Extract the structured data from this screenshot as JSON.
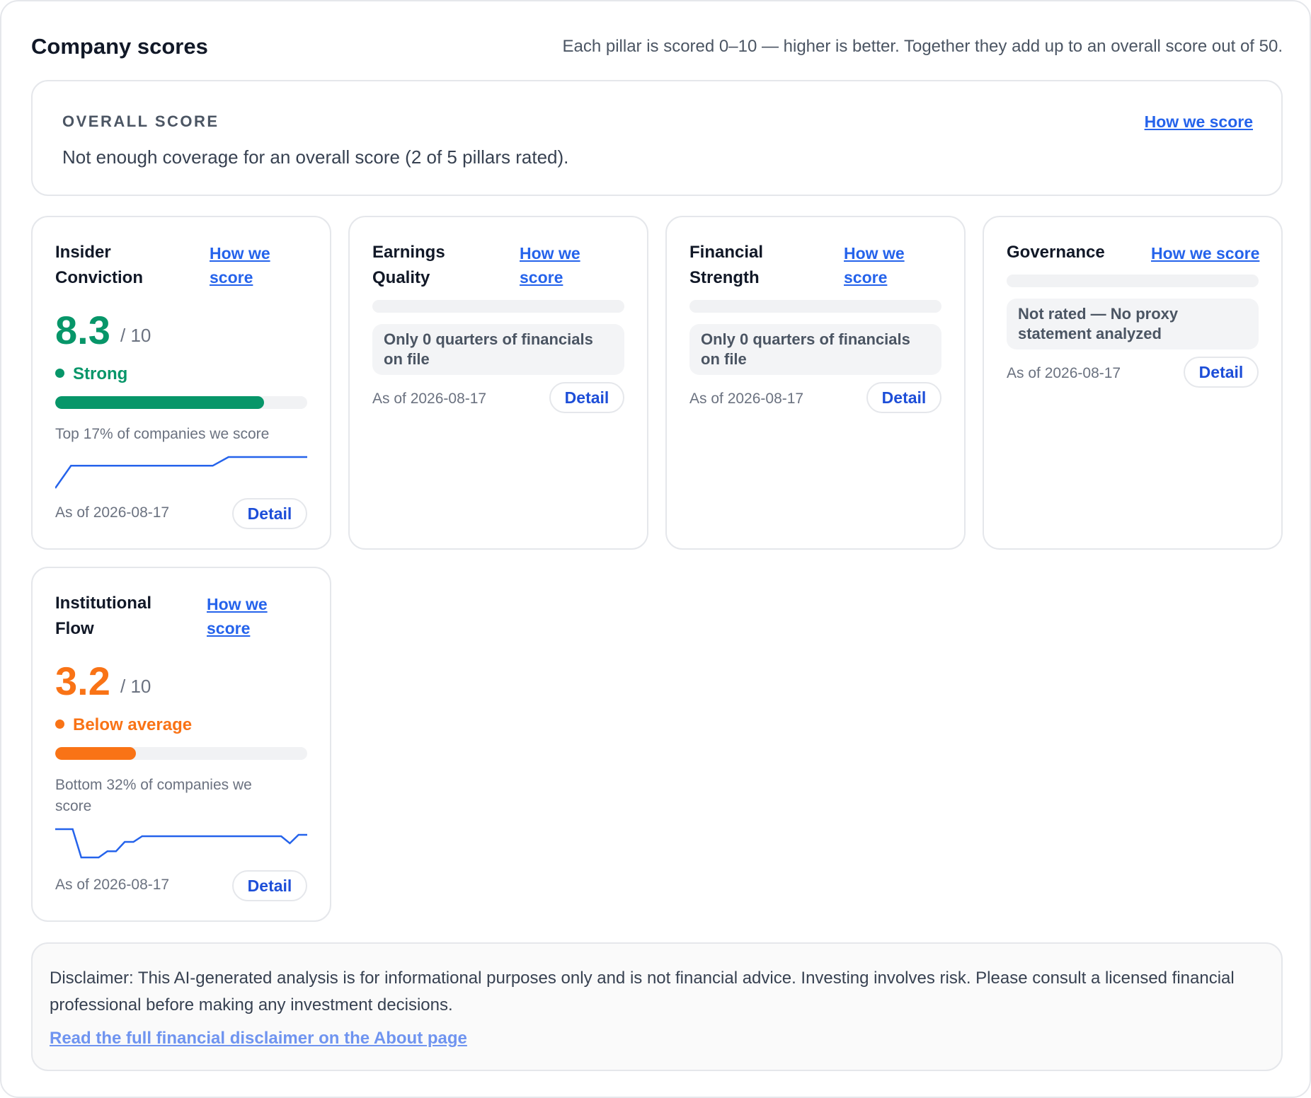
{
  "header": {
    "title": "Company scores",
    "subtitle": "Each pillar is scored 0–10 — higher is better. Together they add up to an overall score out of 50."
  },
  "overall": {
    "label": "OVERALL SCORE",
    "message": "Not enough coverage for an overall score (2 of 5 pillars rated).",
    "how_label": "How we score"
  },
  "pillars": [
    {
      "name": "Insider Conviction",
      "how_label": "How we score",
      "score": "8.3",
      "out_of": "/ 10",
      "band": "Strong",
      "bar_fraction": 0.83,
      "percentile": "Top 17% of companies we score",
      "trend": [
        0,
        0.72,
        0.72,
        0.72,
        0.72,
        0.72,
        0.72,
        0.72,
        0.72,
        0.72,
        0.72,
        1,
        1,
        1,
        1,
        1,
        1
      ],
      "as_of": "As of 2026-08-17",
      "detail_label": "Detail"
    },
    {
      "name": "Earnings Quality",
      "how_label": "How we score",
      "note": "Only 0 quarters of financials on file",
      "as_of": "As of 2026-08-17",
      "detail_label": "Detail"
    },
    {
      "name": "Financial Strength",
      "how_label": "How we score",
      "note": "Only 0 quarters of financials on file",
      "as_of": "As of 2026-08-17",
      "detail_label": "Detail"
    },
    {
      "name": "Governance",
      "how_label": "How we score",
      "note": "Not rated — No proxy statement analyzed",
      "as_of": "As of 2026-08-17",
      "detail_label": "Detail"
    },
    {
      "name": "Institutional Flow",
      "how_label": "How we score",
      "score": "3.2",
      "out_of": "/ 10",
      "band": "Below average",
      "bar_fraction": 0.32,
      "percentile": "Bottom 32% of companies we score",
      "trend": [
        1,
        1,
        1,
        0,
        0,
        0,
        0.22,
        0.22,
        0.55,
        0.55,
        0.75,
        0.75,
        0.75,
        0.75,
        0.75,
        0.75,
        0.75,
        0.75,
        0.75,
        0.75,
        0.75,
        0.75,
        0.75,
        0.75,
        0.75,
        0.75,
        0.75,
        0.5,
        0.8,
        0.8
      ],
      "as_of": "As of 2026-08-17",
      "detail_label": "Detail"
    }
  ],
  "disclaimer": {
    "text": "Disclaimer: This AI-generated analysis is for informational purposes only and is not financial advice. Investing involves risk. Please consult a licensed financial professional before making any investment decisions.",
    "link": "Read the full financial disclaimer on the About page"
  },
  "colors": {
    "strong": "#079669",
    "below_average": "#f97316",
    "link": "#2563eb",
    "sparkline": "#2563eb"
  },
  "icons": {
    "band_dot": "filled-circle"
  }
}
